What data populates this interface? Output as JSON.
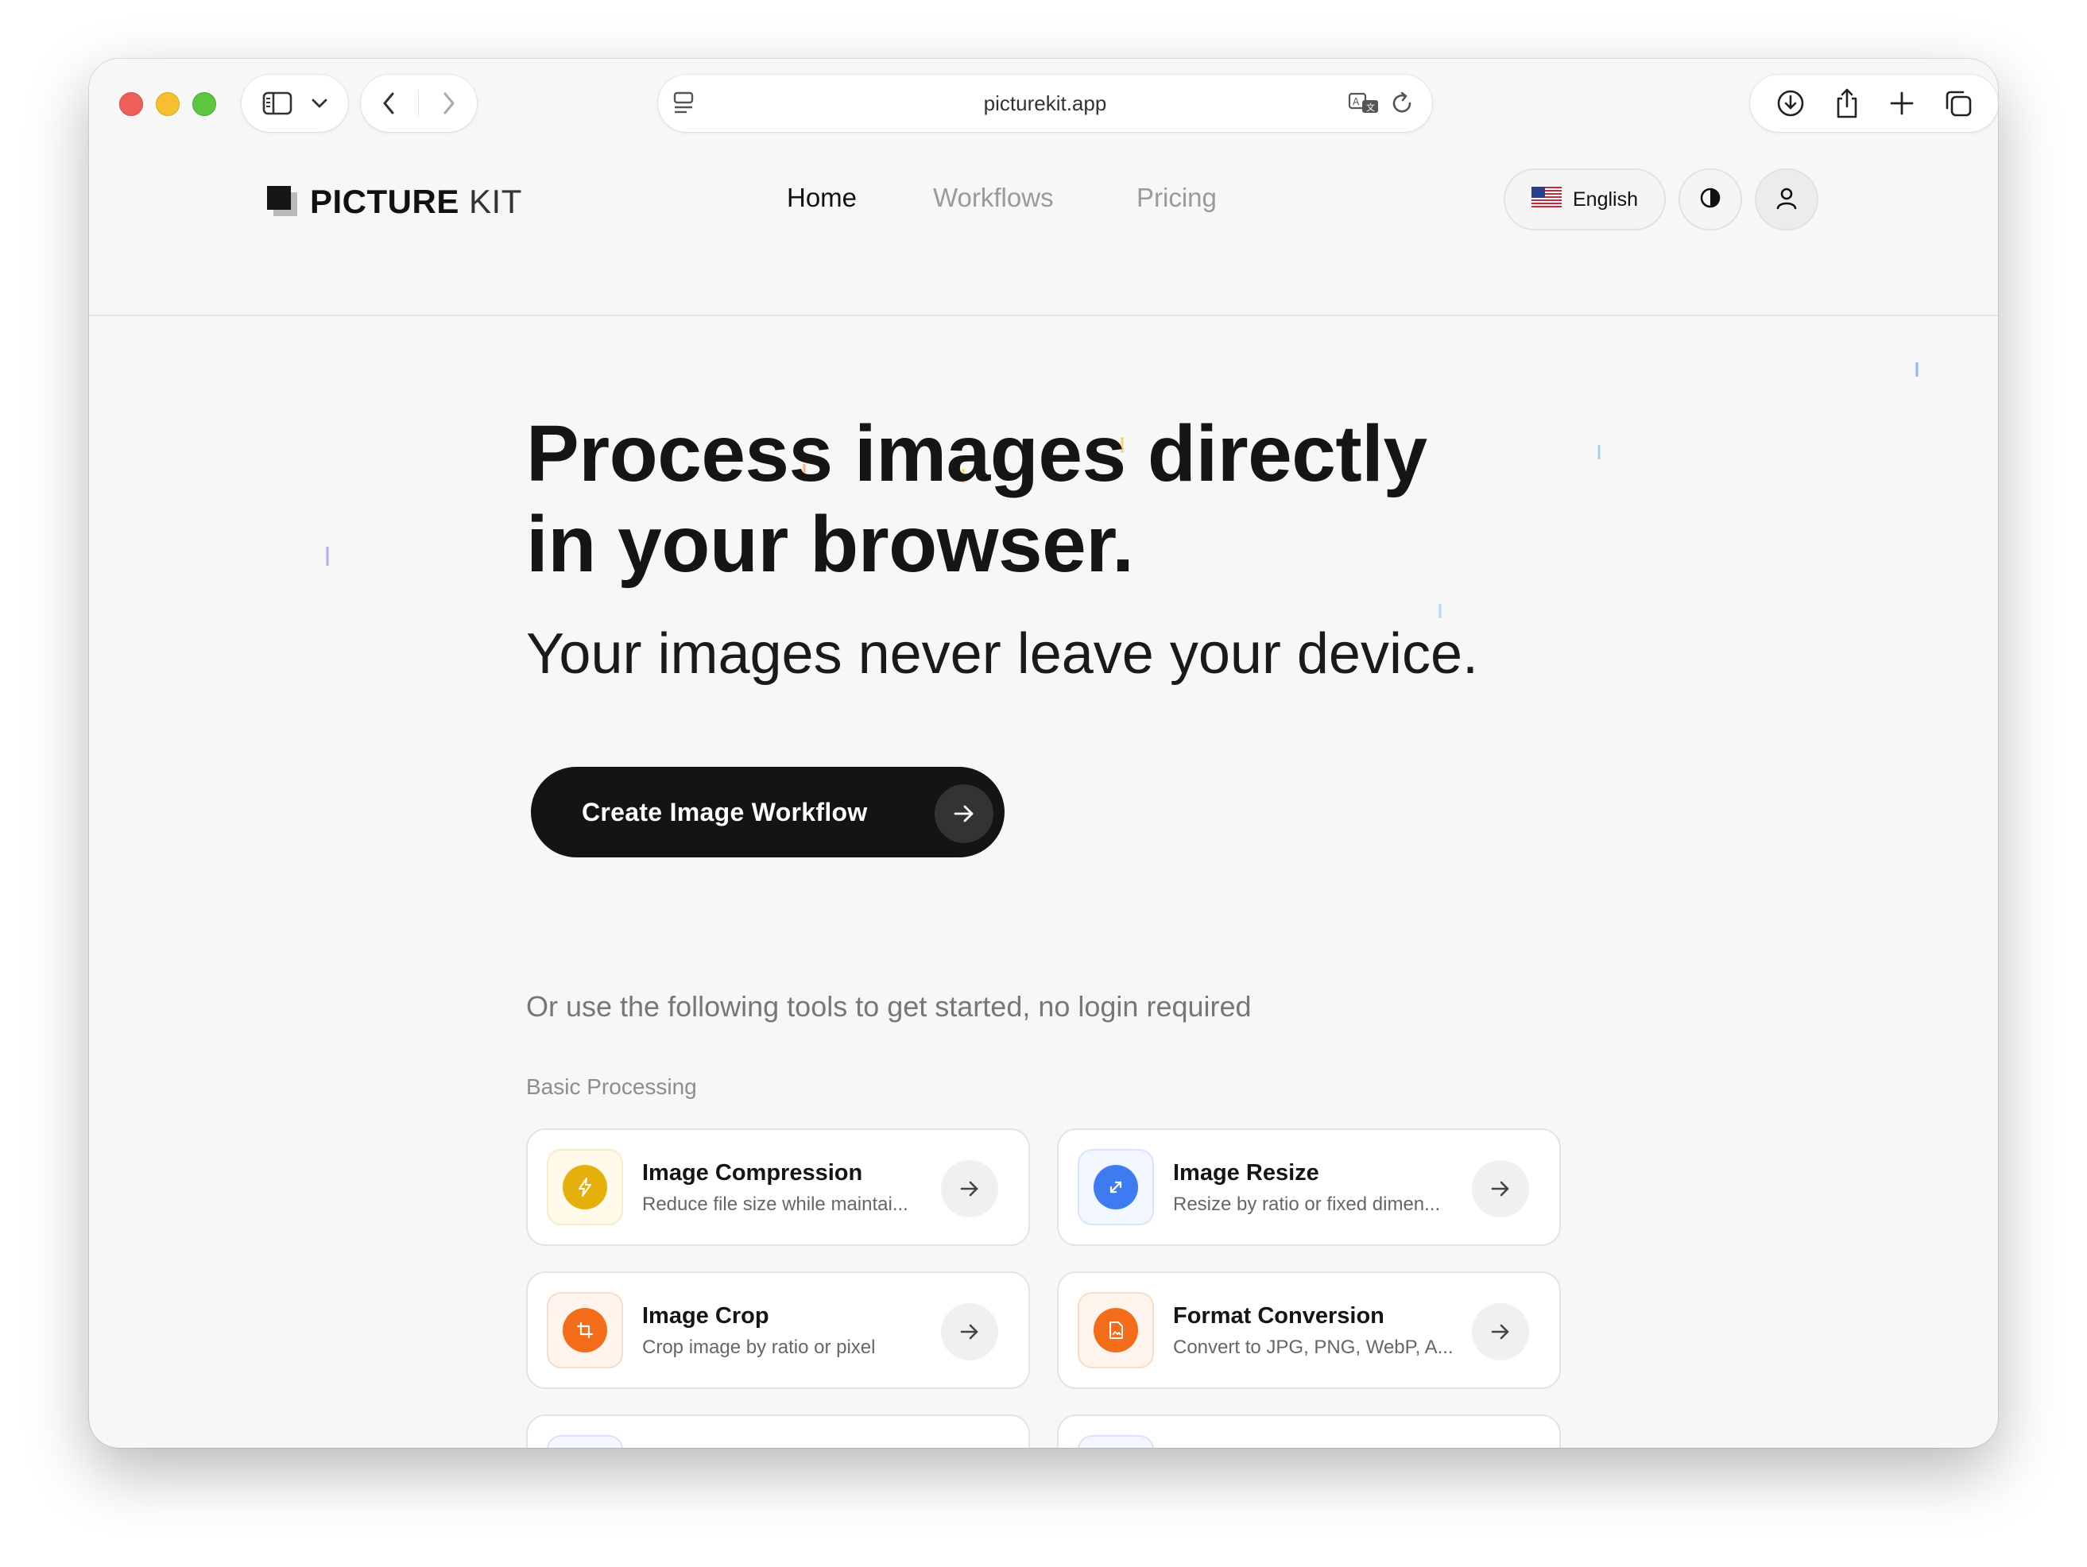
{
  "browser": {
    "url": "picturekit.app",
    "icons": [
      "sidebar-icon",
      "chevron-down-icon",
      "back-icon",
      "forward-icon",
      "page-menu-icon",
      "translate-icon",
      "reload-icon",
      "download-icon",
      "share-icon",
      "new-tab-icon",
      "tab-overview-icon"
    ]
  },
  "header": {
    "logo_bold": "PICTURE",
    "logo_light": "KIT",
    "nav": [
      "Home",
      "Workflows",
      "Pricing"
    ],
    "active_nav": "Home",
    "language": "English"
  },
  "hero": {
    "title_line1": "Process images directly",
    "title_line2": "in your browser.",
    "subtitle": "Your images never leave your device.",
    "cta_label": "Create Image Workflow"
  },
  "tools": {
    "intro": "Or use the following tools to get started, no login required",
    "section_label": "Basic Processing",
    "items": [
      {
        "name": "Image Compression",
        "description": "Reduce file size while maintai...",
        "icon": "lightning-icon",
        "color": "#e5b00c",
        "tint": "#fff8e1"
      },
      {
        "name": "Image Resize",
        "description": "Resize by ratio or fixed dimen...",
        "icon": "expand-icon",
        "color": "#3f7bf0",
        "tint": "#edf3ff"
      },
      {
        "name": "Image Crop",
        "description": "Crop image by ratio or pixel",
        "icon": "crop-icon",
        "color": "#f26c1a",
        "tint": "#fff1e7"
      },
      {
        "name": "Format Conversion",
        "description": "Convert to JPG, PNG, WebP, A...",
        "icon": "file-image-icon",
        "color": "#f26c1a",
        "tint": "#fff1e7"
      }
    ]
  },
  "colors": {
    "page_bg": "#f7f7f7",
    "primary": "#141414",
    "muted_text": "#777777"
  }
}
